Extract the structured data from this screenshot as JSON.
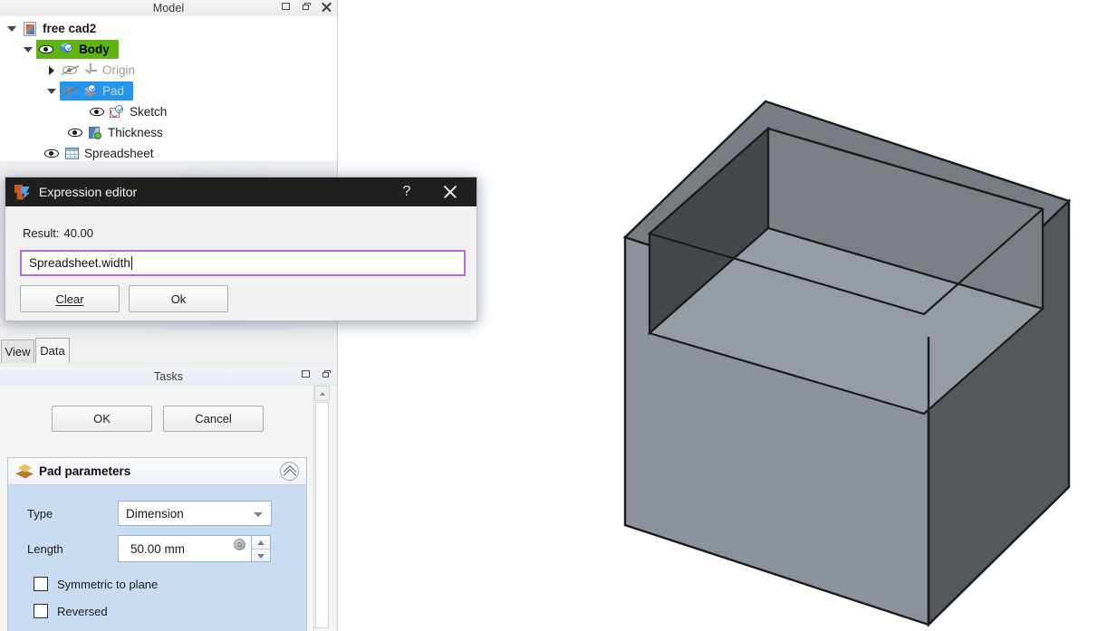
{
  "model_panel": {
    "title": "Model",
    "buttons": [
      {
        "name": "restore",
        "icon": "restore-icon"
      },
      {
        "name": "float",
        "icon": "float-icon"
      },
      {
        "name": "close",
        "icon": "close-icon"
      }
    ],
    "tree": [
      {
        "label": "free cad2",
        "icon": "document-icon",
        "indent": 0,
        "expander": "down",
        "eye": "none",
        "style": "bold"
      },
      {
        "label": "Body",
        "icon": "body-cube-icon",
        "indent": 1,
        "expander": "down",
        "eye": "visible",
        "style": "selected-green"
      },
      {
        "label": "Origin",
        "icon": "origin-axis-icon",
        "indent": 2,
        "expander": "right",
        "eye": "hidden",
        "style": "dim"
      },
      {
        "label": "Pad",
        "icon": "pad-icon",
        "indent": 2,
        "expander": "down",
        "eye": "hidden",
        "style": "selected-blue"
      },
      {
        "label": "Sketch",
        "icon": "sketch-icon",
        "indent": 3,
        "expander": "none",
        "eye": "visible",
        "style": "normal"
      },
      {
        "label": "Thickness",
        "icon": "thickness-icon",
        "indent": 2,
        "expander": "none",
        "eye": "visible",
        "style": "normal"
      },
      {
        "label": "Spreadsheet",
        "icon": "spreadsheet-icon",
        "indent": 1,
        "expander": "none",
        "eye": "visible",
        "style": "normal"
      }
    ]
  },
  "property_tabs": {
    "view_label": "View",
    "data_label": "Data",
    "active": "Data"
  },
  "tasks_panel": {
    "title": "Tasks",
    "ok_label": "OK",
    "cancel_label": "Cancel",
    "pad_parameters": {
      "title": "Pad parameters",
      "type_label": "Type",
      "type_value": "Dimension",
      "length_label": "Length",
      "length_value": "50.00 mm",
      "symmetric_label": "Symmetric to plane",
      "symmetric_checked": false,
      "reversed_label": "Reversed",
      "reversed_checked": false
    }
  },
  "expression_editor": {
    "title": "Expression editor",
    "help_label": "?",
    "result_label": "Result:",
    "result_value": "40.00",
    "expression": "Spreadsheet.width",
    "clear_label_pre": "",
    "clear_label": "Clear",
    "ok_label": "Ok",
    "border_color": "#b06bdd",
    "titlebar_color": "#1f1f1f"
  },
  "viewport_3d": {
    "description": "Isometric view of a hollow rectangular box (open top shell)",
    "face_top_color": "#7b8087",
    "face_left_color": "#8e949c",
    "face_right_color": "#53575c",
    "cavity_floor_color": "#949aa2",
    "cavity_left_color": "#44484d",
    "cavity_right_color": "#7d8289",
    "edge_color": "#1c1c1c",
    "background": "#ffffff"
  }
}
